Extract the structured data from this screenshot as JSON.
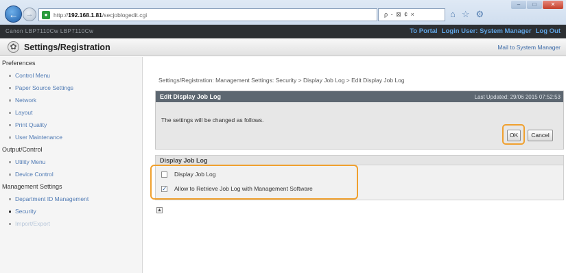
{
  "browser": {
    "window_controls": [
      "–",
      "□",
      "✕"
    ],
    "address_prefix": "http://",
    "address_host": "192.168.1.81",
    "address_path": "/secjoblogedit.cgi",
    "search_text": "ρ - ⊠ ¢ ×",
    "tool_icons": [
      "home-icon",
      "star-icon",
      "gear-icon"
    ]
  },
  "header": {
    "device_name": "Canon LBP7110Cw  LBP7110Cw",
    "links": [
      "To Portal",
      "Login User: System Manager",
      "Log Out"
    ],
    "title": "Settings/Registration",
    "mail_link": "Mail to System Manager"
  },
  "sidebar": {
    "groups": [
      {
        "label": "Preferences",
        "items": [
          "Control Menu",
          "Paper Source Settings",
          "Network",
          "Layout",
          "Print Quality",
          "User Maintenance"
        ]
      },
      {
        "label": "Output/Control",
        "items": [
          "Utility Menu",
          "Device Control"
        ]
      },
      {
        "label": "Management Settings",
        "items": [
          "Department ID Management",
          "Security",
          "Import/Export"
        ]
      }
    ]
  },
  "main": {
    "breadcrumb": "Settings/Registration: Management Settings: Security > Display Job Log > Edit Display Job Log",
    "edit_panel": {
      "title": "Edit Display Job Log",
      "last_updated": "Last Updated: 29/06 2015 07:52:53",
      "message": "The settings will be changed as follows.",
      "ok_label": "OK",
      "cancel_label": "Cancel"
    },
    "job_log_panel": {
      "title": "Display Job Log",
      "options": [
        {
          "label": "Display Job Log",
          "checked": false
        },
        {
          "label": "Allow to Retrieve Job Log with Management Software",
          "checked": true
        }
      ]
    },
    "top_link_icon": "▲"
  },
  "colors": {
    "highlight": "#f0a02e",
    "panel_header": "#5d6771",
    "link": "#4f7ab4"
  }
}
